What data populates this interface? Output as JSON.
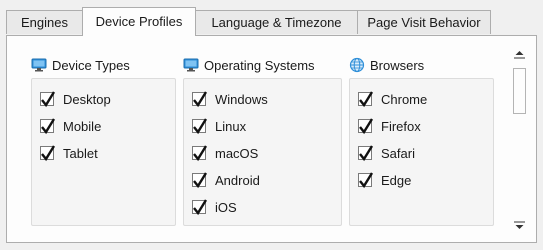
{
  "tabs": [
    {
      "label": "Engines",
      "active": false
    },
    {
      "label": "Device Profiles",
      "active": true
    },
    {
      "label": "Language & Timezone",
      "active": false
    },
    {
      "label": "Page Visit Behavior",
      "active": false
    }
  ],
  "groups": {
    "device_types": {
      "title": "Device Types",
      "icon": "monitor-icon",
      "items": [
        {
          "label": "Desktop",
          "checked": true
        },
        {
          "label": "Mobile",
          "checked": true
        },
        {
          "label": "Tablet",
          "checked": true
        }
      ]
    },
    "operating_systems": {
      "title": "Operating Systems",
      "icon": "monitor-icon",
      "items": [
        {
          "label": "Windows",
          "checked": true
        },
        {
          "label": "Linux",
          "checked": true
        },
        {
          "label": "macOS",
          "checked": true
        },
        {
          "label": "Android",
          "checked": true
        },
        {
          "label": "iOS",
          "checked": true
        }
      ]
    },
    "browsers": {
      "title": "Browsers",
      "icon": "globe-icon",
      "items": [
        {
          "label": "Chrome",
          "checked": true
        },
        {
          "label": "Firefox",
          "checked": true
        },
        {
          "label": "Safari",
          "checked": true
        },
        {
          "label": "Edge",
          "checked": true
        }
      ]
    }
  },
  "colors": {
    "accent_icon": "#2f8fd8",
    "panel_bg": "#fdfdfd",
    "border": "#adadad"
  }
}
